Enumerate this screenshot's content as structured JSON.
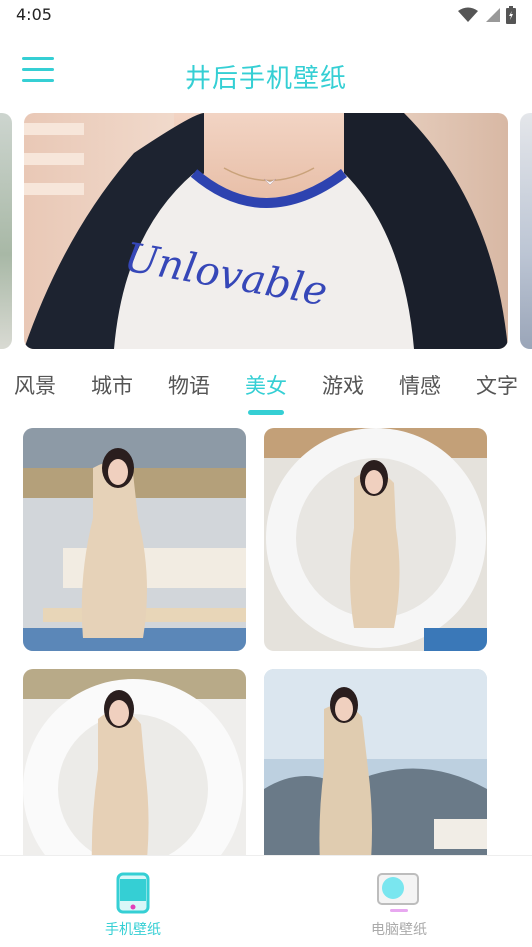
{
  "status_bar": {
    "time": "4:05"
  },
  "app_bar": {
    "title": "井后手机壁纸"
  },
  "categories": [
    {
      "label": "风景"
    },
    {
      "label": "城市"
    },
    {
      "label": "物语"
    },
    {
      "label": "美女"
    },
    {
      "label": "游戏"
    },
    {
      "label": "情感"
    },
    {
      "label": "文字"
    }
  ],
  "active_category": "美女",
  "banner": {
    "shirt_text": "Unlovable"
  },
  "bottom_nav": {
    "items": [
      {
        "label": "手机壁纸",
        "icon": "phone-icon",
        "active": true
      },
      {
        "label": "电脑壁纸",
        "icon": "monitor-icon",
        "active": false
      }
    ]
  },
  "colors": {
    "accent": "#35cfd4",
    "inactive": "#aaaaaa",
    "text": "#555555"
  }
}
